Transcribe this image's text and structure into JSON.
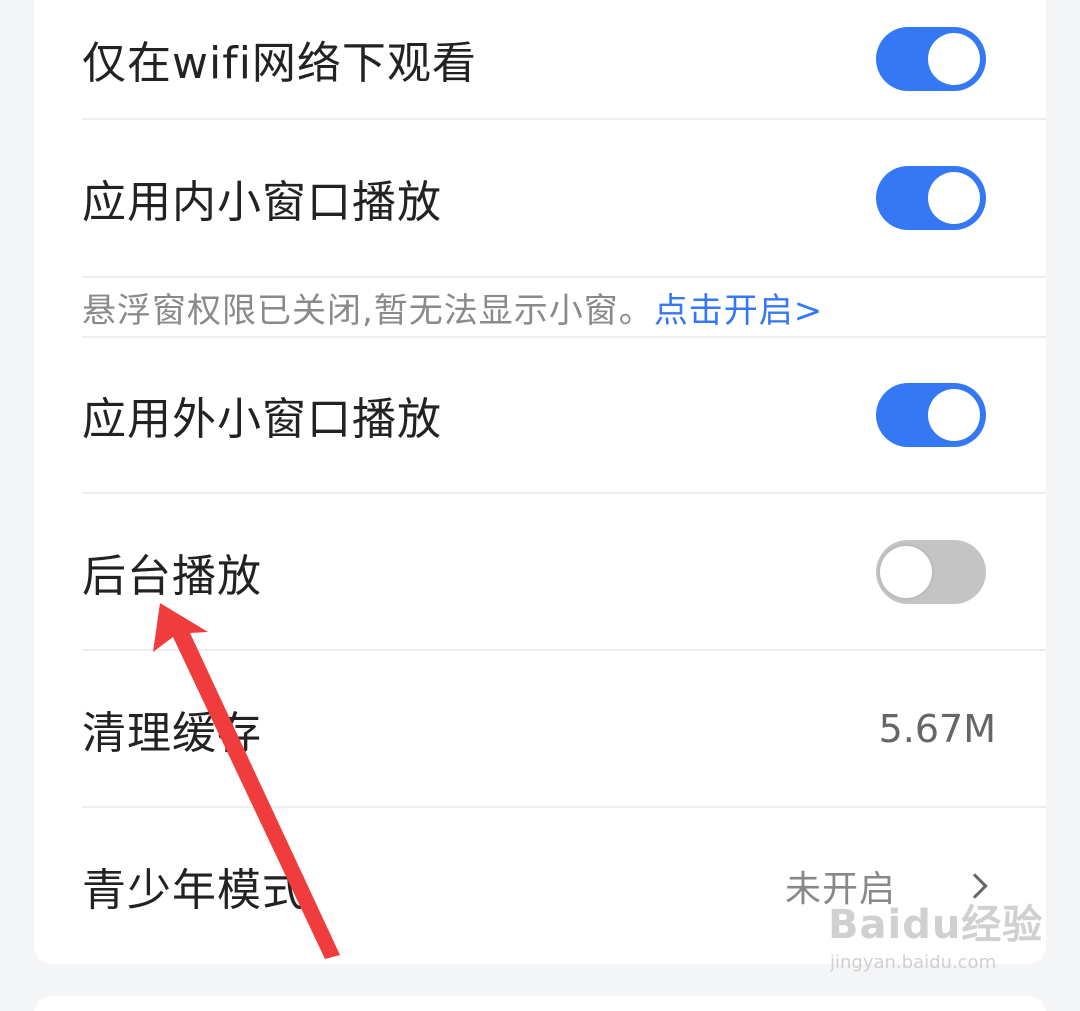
{
  "settings": {
    "wifi_only": {
      "label": "仅在wifi网络下观看",
      "enabled": true
    },
    "in_app_pip": {
      "label": "应用内小窗口播放",
      "enabled": true
    },
    "notice": {
      "text": "悬浮窗权限已关闭,暂无法显示小窗。",
      "link": "点击开启>"
    },
    "out_app_pip": {
      "label": "应用外小窗口播放",
      "enabled": true
    },
    "background_play": {
      "label": "后台播放",
      "enabled": false
    },
    "clear_cache": {
      "label": "清理缓存",
      "value": "5.67M"
    },
    "teen_mode": {
      "label": "青少年模式",
      "value": "未开启"
    }
  },
  "icons": {
    "toggle": "toggle-switch",
    "chevron": "chevron-right-icon",
    "annotation": "red-arrow"
  },
  "colors": {
    "accent": "#3478f6",
    "toggle_off": "#c4c4c4",
    "annotation_arrow": "#f03c3c"
  },
  "watermark": {
    "main": "Baidu经验",
    "sub": "jingyan.baidu.com"
  }
}
